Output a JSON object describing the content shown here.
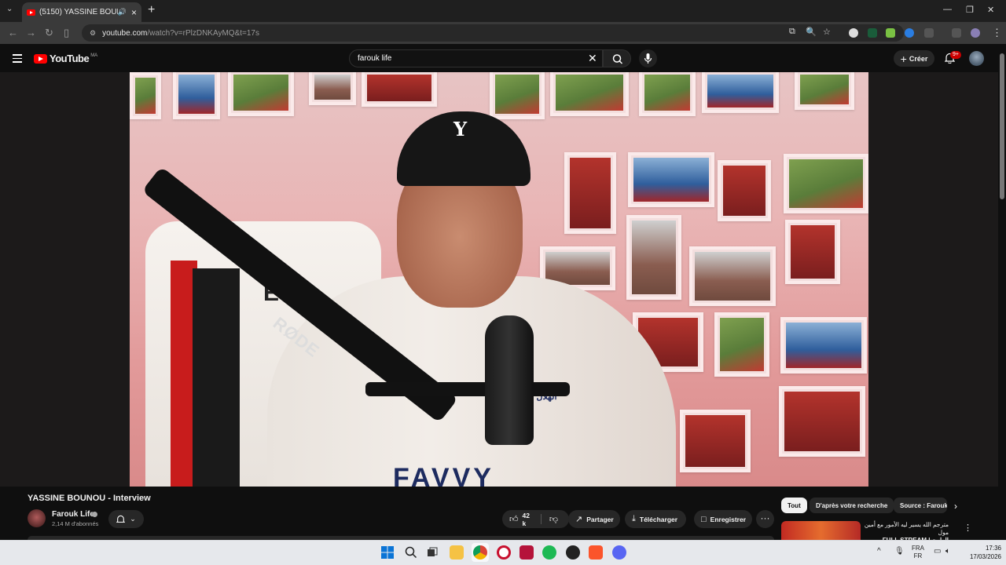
{
  "browser": {
    "tab_title": "(5150) YASSINE BOUNOU - ",
    "url_domain": "youtube.com",
    "url_path": "/watch?v=rPlzDNKAyMQ&t=17s"
  },
  "youtube": {
    "logo_text": "YouTube",
    "country_code": "MA",
    "search_value": "farouk life",
    "create_label": "Créer",
    "notification_count": "9+"
  },
  "video": {
    "jersey_text": "EGA",
    "mic_brand": "RØDE",
    "club_text": "ALHILAL\nالهلال",
    "sponsor_text": "FAVVY"
  },
  "watch": {
    "title": "YASSINE BOUNOU - Interview",
    "channel_name": "Farouk Life",
    "subscribers": "2,14 M d'abonnés",
    "like_count": "42 k",
    "share_label": "Partager",
    "download_label": "Télécharger",
    "save_label": "Enregistrer",
    "more_label": "···"
  },
  "chips": {
    "all": "Tout",
    "related": "D'après votre recherche",
    "source": "Source : Farouk"
  },
  "recommendation": {
    "title_line1": "مترجم الله يسير ليه الأمور مع أمين مول",
    "title_line2": "FULL STREAM | الطون"
  },
  "taskbar": {
    "lang_top": "FRA",
    "lang_bottom": "FR",
    "time": "17:36",
    "date": "17/03/2026"
  },
  "colors": {
    "youtube_red": "#ff0000",
    "background": "#0f0f0f",
    "pill": "#272727"
  }
}
